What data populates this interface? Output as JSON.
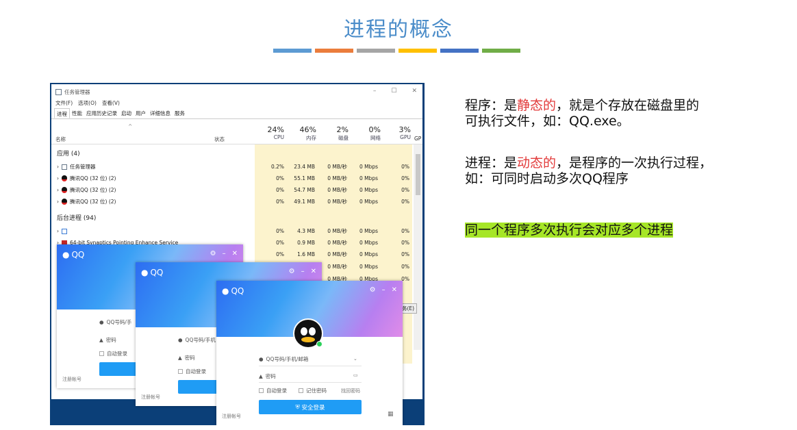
{
  "slide": {
    "title": "进程的概念",
    "bar_colors": [
      "#5d9bd3",
      "#eb7d3c",
      "#a5a5a5",
      "#ffc000",
      "#4472c4",
      "#70ad47"
    ]
  },
  "taskmgr": {
    "title": "任务管理器",
    "menu": [
      "文件(F)",
      "选项(O)",
      "查看(V)"
    ],
    "tabs": [
      "进程",
      "性能",
      "应用历史记录",
      "启动",
      "用户",
      "详细信息",
      "服务"
    ],
    "header": {
      "name": "名称",
      "status": "状态",
      "columns": [
        {
          "pct": "24%",
          "label": "CPU"
        },
        {
          "pct": "46%",
          "label": "内存"
        },
        {
          "pct": "2%",
          "label": "磁盘"
        },
        {
          "pct": "0%",
          "label": "网络"
        },
        {
          "pct": "3%",
          "label": "GPU"
        }
      ],
      "gp": "GP"
    },
    "groups": {
      "apps": "应用 (4)",
      "background": "后台进程 (94)"
    },
    "apps": [
      {
        "name": "任务管理器",
        "cpu": "0.2%",
        "mem": "23.4 MB",
        "disk": "0 MB/秒",
        "net": "0 Mbps",
        "gpu": "0%"
      },
      {
        "name": "腾讯QQ (32 位) (2)",
        "cpu": "0%",
        "mem": "55.1 MB",
        "disk": "0 MB/秒",
        "net": "0 Mbps",
        "gpu": "0%"
      },
      {
        "name": "腾讯QQ (32 位) (2)",
        "cpu": "0%",
        "mem": "54.7 MB",
        "disk": "0 MB/秒",
        "net": "0 Mbps",
        "gpu": "0%"
      },
      {
        "name": "腾讯QQ (32 位) (2)",
        "cpu": "0%",
        "mem": "49.1 MB",
        "disk": "0 MB/秒",
        "net": "0 Mbps",
        "gpu": "0%"
      }
    ],
    "background": [
      {
        "name": "",
        "cpu": "0%",
        "mem": "4.3 MB",
        "disk": "0 MB/秒",
        "net": "0 Mbps",
        "gpu": "0%"
      },
      {
        "name": "64-bit Synaptics Pointing Enhance Service",
        "cpu": "0%",
        "mem": "0.9 MB",
        "disk": "0 MB/秒",
        "net": "0 Mbps",
        "gpu": "0%"
      },
      {
        "name": "",
        "cpu": "0%",
        "mem": "1.6 MB",
        "disk": "0 MB/秒",
        "net": "0 Mbps",
        "gpu": "0%"
      },
      {
        "name": "",
        "cpu": "",
        "mem": "",
        "disk": "0 MB/秒",
        "net": "0 Mbps",
        "gpu": "0%"
      },
      {
        "name": "",
        "cpu": "",
        "mem": "",
        "disk": "0 MB/秒",
        "net": "0 Mbps",
        "gpu": "0%"
      }
    ],
    "end_task": "务(E)"
  },
  "qq": {
    "logo": "QQ",
    "account_placeholder": "QQ号码/手机/邮箱",
    "account_short1": "QQ号码/手",
    "account_short2": "QQ号码/手机",
    "password": "密码",
    "auto_login": "自动登录",
    "remember": "记住密码",
    "retrieve": "找回密码",
    "login": "安全登录",
    "register": "注册帐号"
  },
  "notes": {
    "p1_a": "程序：是",
    "p1_red": "静态的",
    "p1_b": "，就是个存放在磁盘里的",
    "p1_c": "可执行文件，如：QQ.exe。",
    "p2_a": "进程：是",
    "p2_red": "动态的",
    "p2_b": "，是程序的一次执行过程，",
    "p2_c": "如：可同时启动多次QQ程序",
    "p3": "同一个程序多次执行会对应多个进程"
  }
}
